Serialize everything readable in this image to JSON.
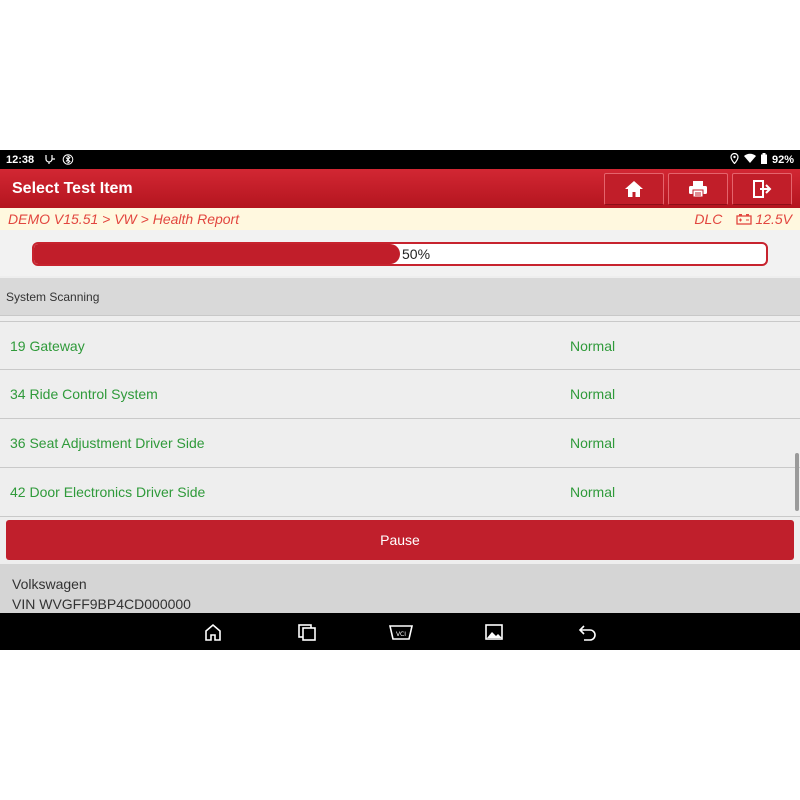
{
  "status_bar": {
    "time": "12:38",
    "battery": "92%"
  },
  "title_bar": {
    "title": "Select Test Item"
  },
  "breadcrumb": {
    "path": "DEMO V15.51 > VW > Health Report",
    "dlc": "DLC",
    "voltage": "12.5V"
  },
  "progress": {
    "value": 0.5,
    "label": "50%"
  },
  "section": {
    "title": "System Scanning"
  },
  "systems": [
    {
      "name": "19 Gateway",
      "status": "Normal"
    },
    {
      "name": "34 Ride Control System",
      "status": "Normal"
    },
    {
      "name": "36 Seat Adjustment Driver Side",
      "status": "Normal"
    },
    {
      "name": "42 Door Electronics Driver Side",
      "status": "Normal"
    }
  ],
  "pause_button": {
    "label": "Pause"
  },
  "vehicle": {
    "make": "Volkswagen",
    "vin": "VIN WVGFF9BP4CD000000"
  },
  "colors": {
    "accent": "#c11e2a",
    "status_ok": "#2f9a3a",
    "breadcrumb": "#e2463f"
  }
}
